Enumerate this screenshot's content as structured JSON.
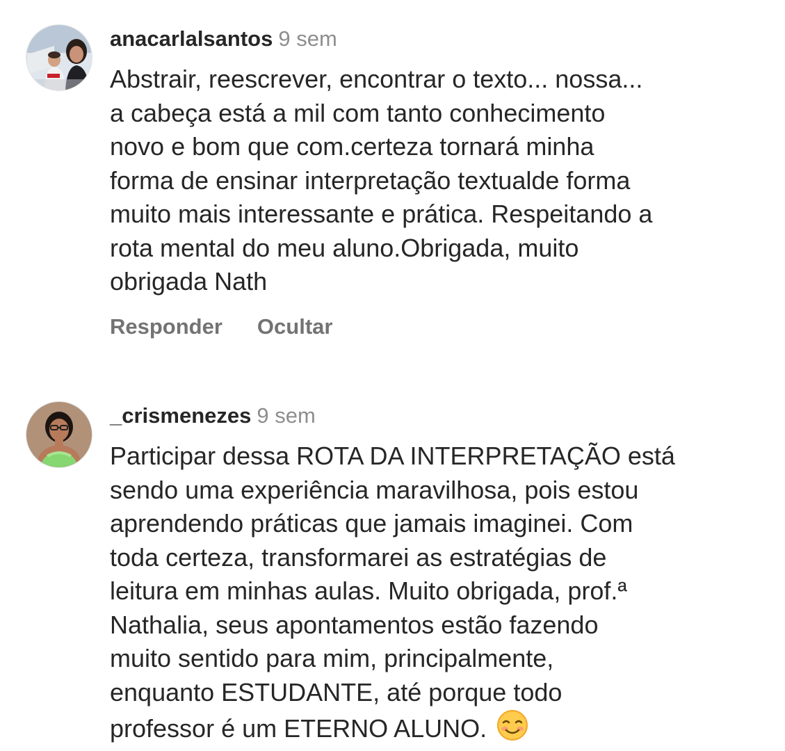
{
  "comments": [
    {
      "username": "anacarlalsantos",
      "time": "9 sem",
      "lines": [
        "Abstrair, reescrever, encontrar o texto... nossa...",
        "a cabeça está a mil com tanto conhecimento",
        "novo e bom que com.certeza tornará minha",
        "forma de ensinar interpretação textualde forma",
        "muito mais interessante e prática. Respeitando a",
        "rota mental do meu aluno.Obrigada, muito",
        "obrigada Nath"
      ],
      "actions": {
        "reply": "Responder",
        "hide": "Ocultar"
      },
      "avatar_icon": "user-photo-icon"
    },
    {
      "username": "_crismenezes",
      "time": "9 sem",
      "lines": [
        "Participar dessa ROTA DA INTERPRETAÇÃO está",
        "sendo uma experiência maravilhosa, pois estou",
        "aprendendo práticas que jamais imaginei. Com",
        "toda certeza, transformarei as estratégias de",
        "leitura em minhas aulas. Muito obrigada, prof.ª",
        "Nathalia, seus apontamentos estão fazendo",
        "muito sentido para mim, principalmente,",
        "enquanto ESTUDANTE, até porque todo",
        "professor é um ETERNO ALUNO."
      ],
      "emoji": "smiling-face-icon",
      "avatar_icon": "user-photo-icon"
    }
  ],
  "colors": {
    "text": "#262626",
    "secondary": "#8e8e8e",
    "action": "#737373"
  }
}
